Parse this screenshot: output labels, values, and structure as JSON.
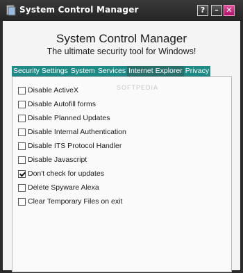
{
  "window": {
    "title": "System Control Manager",
    "help_glyph": "?",
    "minimize_glyph": "–",
    "close_glyph": "✕",
    "accent": "#1e8a86"
  },
  "header": {
    "title": "System Control Manager",
    "subtitle": "The ultimate security tool for Windows!"
  },
  "tabs": [
    {
      "label": "Security Settings"
    },
    {
      "label": "System"
    },
    {
      "label": "Services"
    },
    {
      "label": "Internet Explorer",
      "active": true
    },
    {
      "label": "Privacy"
    }
  ],
  "watermark": "SOFTPEDIA",
  "options": [
    {
      "label": "Disable ActiveX",
      "checked": false
    },
    {
      "label": "Disable Autofill forms",
      "checked": false
    },
    {
      "label": "Disable Planned Updates",
      "checked": false
    },
    {
      "label": "Disable Internal Authentication",
      "checked": false
    },
    {
      "label": "Disable ITS Protocol Handler",
      "checked": false
    },
    {
      "label": "Disable Javascript",
      "checked": false
    },
    {
      "label": "Don't check for updates",
      "checked": true
    },
    {
      "label": "Delete Spyware Alexa",
      "checked": false
    },
    {
      "label": "Clear Temporary Files on exit",
      "checked": false
    }
  ]
}
